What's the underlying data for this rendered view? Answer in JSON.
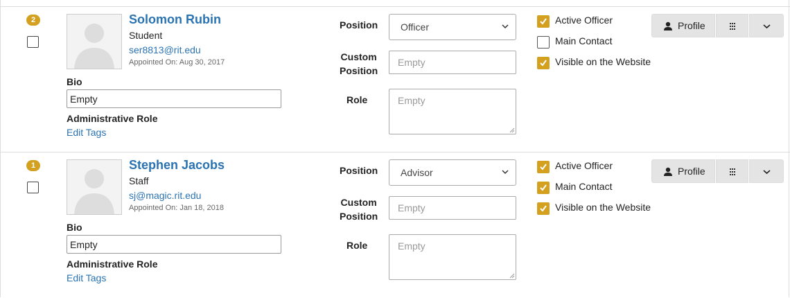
{
  "fields": {
    "position_label": "Position",
    "custom_label_line1": "Custom",
    "custom_label_line2": "Position",
    "role_label": "Role",
    "bio_label": "Bio",
    "admin_role_label": "Administrative Role",
    "edit_tags_label": "Edit Tags",
    "empty_text": "Empty",
    "profile_button_label": "Profile",
    "active_officer_label": "Active Officer",
    "main_contact_label": "Main Contact",
    "visible_label": "Visible on the Website"
  },
  "colors": {
    "accent": "#d4a020",
    "link": "#2a73b3",
    "button_bg": "#e4e4e4"
  },
  "icons": [
    "person-icon",
    "grid-icon",
    "chevron-down-icon",
    "checkmark-icon",
    "avatar-placeholder-icon"
  ],
  "members": [
    {
      "order_badge": "2",
      "name": "Solomon Rubin",
      "type": "Student",
      "email": "ser8813@rit.edu",
      "appointed": "Appointed On: Aug 30, 2017",
      "bio": "Empty",
      "position": "Officer",
      "custom_position": "Empty",
      "role": "Empty",
      "active_officer": true,
      "main_contact": false,
      "visible_on_website": true
    },
    {
      "order_badge": "1",
      "name": "Stephen Jacobs",
      "type": "Staff",
      "email": "sj@magic.rit.edu",
      "appointed": "Appointed On: Jan 18, 2018",
      "bio": "Empty",
      "position": "Advisor",
      "custom_position": "Empty",
      "role": "Empty",
      "active_officer": true,
      "main_contact": true,
      "visible_on_website": true
    }
  ]
}
